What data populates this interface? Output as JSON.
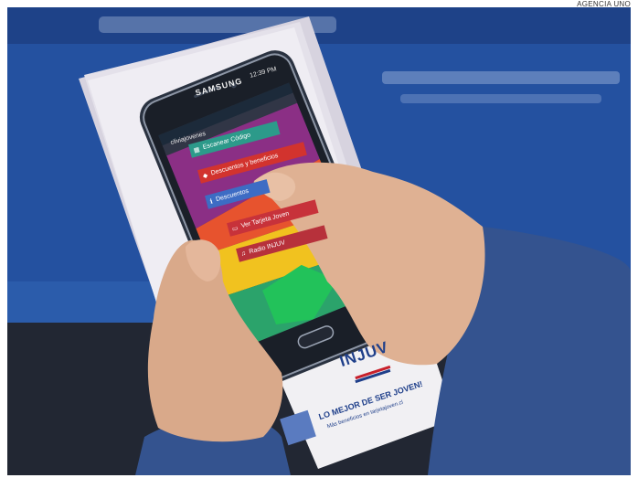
{
  "photo_credit": "AGENCIA UNO",
  "phone": {
    "brand": "SAMSUNG",
    "status_time": "12:39 PM",
    "app_user": "cliviajovenes",
    "menu_items": [
      {
        "label": "Escanear Código",
        "icon": "grid-icon",
        "color": "#2c9a8a"
      },
      {
        "label": "Descuentos y beneficios",
        "icon": "tag-icon",
        "color": "#d2332e"
      },
      {
        "label": "Descuentos",
        "icon": "info-icon",
        "color": "#3d6cc4"
      },
      {
        "label": "Ver Tarjeta Joven",
        "icon": "card-icon",
        "color": "#c7323a"
      },
      {
        "label": "Radio INJUV",
        "icon": "headphones-icon",
        "color": "#b7313b"
      }
    ]
  },
  "card": {
    "logo": "INJUV",
    "tagline": "LO MEJOR DE SER JOVEN!",
    "subline": "Más beneficios en tarjetajoven.cl"
  },
  "colors": {
    "background_blue": "#2a5aa8",
    "sleeve_blue": "#34538f",
    "injuv_blue": "#1f3f8a",
    "skin": "#e3b89a"
  }
}
